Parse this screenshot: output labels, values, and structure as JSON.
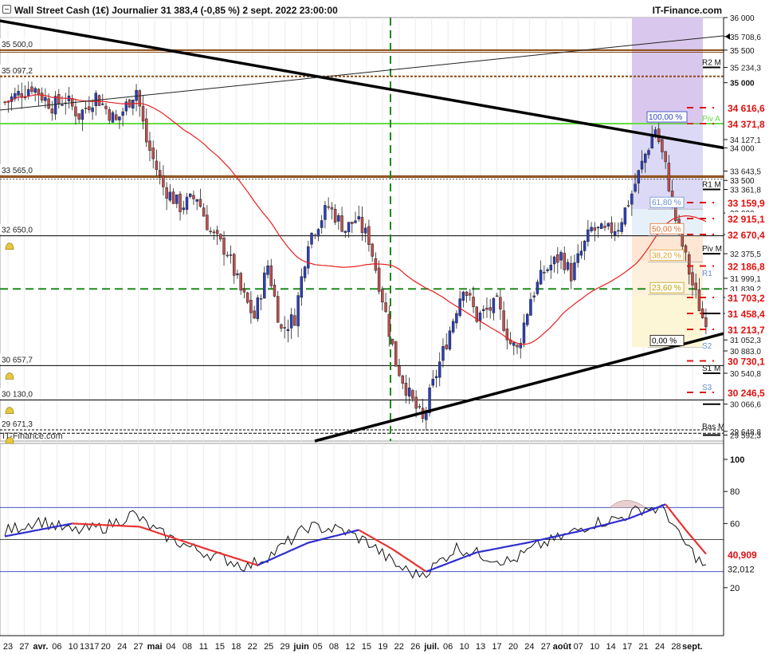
{
  "header": {
    "title": "Wall Street Cash (1€) Journalier 31 383,4 (-0,85 %) 2 sept. 2022 23:00:00",
    "brand": "IT-Finance.com",
    "watermark": "IT-Finance.com"
  },
  "chart_data": [
    {
      "type": "candlestick",
      "ylim": [
        29500,
        36000
      ],
      "y_ticks": [
        29592.3,
        29648.8,
        30066.6,
        30540.8,
        30883.0,
        31052.3,
        31458.4,
        31703.2,
        31839.2,
        31999.1,
        32375.5,
        32670.4,
        33361.8,
        33643.5,
        34127.1,
        35234.3,
        35708.6
      ],
      "y_tick_labels": [
        "29 592,3",
        "29 648,8",
        "30 066,6",
        "30 540,8",
        "30 883,0",
        "31 052,3",
        "31 458,4",
        "31 703,2",
        "31 839,2",
        "31 999,1",
        "32 375,5",
        "32 670,4",
        "33 361,8",
        "33 643,5",
        "34 127,1",
        "35 234,3",
        "35 708,6"
      ],
      "y_plain_ticks": [
        {
          "v": 36000,
          "label": "36 000"
        },
        {
          "v": 35500,
          "label": "35 500"
        },
        {
          "v": 35000,
          "label": "35 000"
        },
        {
          "v": 34000,
          "label": "34 000"
        },
        {
          "v": 33500,
          "label": "33 500"
        },
        {
          "v": 33000,
          "label": "33 000"
        }
      ],
      "highlight_levels": [
        {
          "v": 34616.6,
          "label": "34 616,6"
        },
        {
          "v": 34371.8,
          "label": "34 371,8"
        },
        {
          "v": 33159.9,
          "label": "33 159,9"
        },
        {
          "v": 32915.1,
          "label": "32 915,1"
        },
        {
          "v": 32670.4,
          "label": "32 670,4"
        },
        {
          "v": 32186.8,
          "label": "32 186,8"
        },
        {
          "v": 31703.2,
          "label": "31 703,2"
        },
        {
          "v": 31458.4,
          "label": "31 458,4"
        },
        {
          "v": 31213.7,
          "label": "31 213,7"
        },
        {
          "v": 30730.1,
          "label": "30 730,1"
        },
        {
          "v": 30246.5,
          "label": "30 246,5"
        }
      ],
      "left_levels": [
        {
          "v": 35500,
          "label": "35 500,0",
          "color": "#8b4a12"
        },
        {
          "v": 35097.2,
          "label": "35 097,2",
          "color": "#8b4a12"
        },
        {
          "v": 33565,
          "label": "33 565,0",
          "color": "#8b4a12"
        },
        {
          "v": 32650,
          "label": "32 650,0",
          "color": "#000000"
        },
        {
          "v": 30657.7,
          "label": "30 657,7",
          "color": "#000000"
        },
        {
          "v": 30130,
          "label": "30 130,0",
          "color": "#000000"
        },
        {
          "v": 29671.3,
          "label": "29 671,3",
          "color": "#000000"
        }
      ],
      "pivot_labels": [
        {
          "text": "R2 M",
          "v": 35234.3
        },
        {
          "text": "R1 M",
          "v": 33361.8
        },
        {
          "text": "Piv M",
          "v": 32375.5
        },
        {
          "text": "S1 M",
          "v": 30540.8
        },
        {
          "text": "Piv A",
          "v": 34371.8
        },
        {
          "text": "S2",
          "v": 30883.0
        },
        {
          "text": "S3",
          "v": 30246.5
        },
        {
          "text": "R1",
          "v": 31999.1
        },
        {
          "text": "Bas M",
          "v": 29648.8
        }
      ],
      "fib_levels": [
        {
          "label": "100,00 %",
          "v": 34371.8
        },
        {
          "label": "61,80 %",
          "v": 33060
        },
        {
          "label": "50,00 %",
          "v": 32655
        },
        {
          "label": "38,20 %",
          "v": 32250
        },
        {
          "label": "23,60 %",
          "v": 31750
        },
        {
          "label": "0,00 %",
          "v": 30940
        }
      ],
      "x_labels": [
        "23",
        "27",
        "avr.",
        "06",
        "10",
        "1317",
        "20",
        "24",
        "27",
        "mai",
        "04",
        "08",
        "11",
        "15",
        "18",
        "22",
        "25",
        "29",
        "juin",
        "05",
        "08",
        "12",
        "15",
        "19",
        "22",
        "26",
        "juil.",
        "06",
        "10",
        "13",
        "17",
        "20",
        "24",
        "27",
        "août",
        "07",
        "10",
        "14",
        "17",
        "21",
        "24",
        "28",
        "sept."
      ]
    },
    {
      "type": "line",
      "ylim": [
        0,
        100
      ],
      "y_ticks": [
        {
          "v": 100,
          "label": "100"
        },
        {
          "v": 80,
          "label": "80"
        },
        {
          "v": 60,
          "label": "60"
        },
        {
          "v": 20,
          "label": "20"
        }
      ],
      "levels": [
        70,
        50,
        30
      ],
      "last_values": [
        {
          "v": 40.909,
          "label": "40,909"
        },
        {
          "v": 32.012,
          "label": "32,012"
        }
      ]
    }
  ],
  "colors": {
    "up": "#2b3fbf",
    "down": "#c0504d",
    "ma": "#e82020",
    "trend": "#000000",
    "brown": "#8b4a12",
    "green": "#00aa00",
    "lime": "#66dd44",
    "fib_top": "#dcd9f6",
    "fib_mid": "#fde7d4",
    "fib_low": "#fdf6d6",
    "purple": "#d9c7ee",
    "red_label": "#e01010"
  }
}
